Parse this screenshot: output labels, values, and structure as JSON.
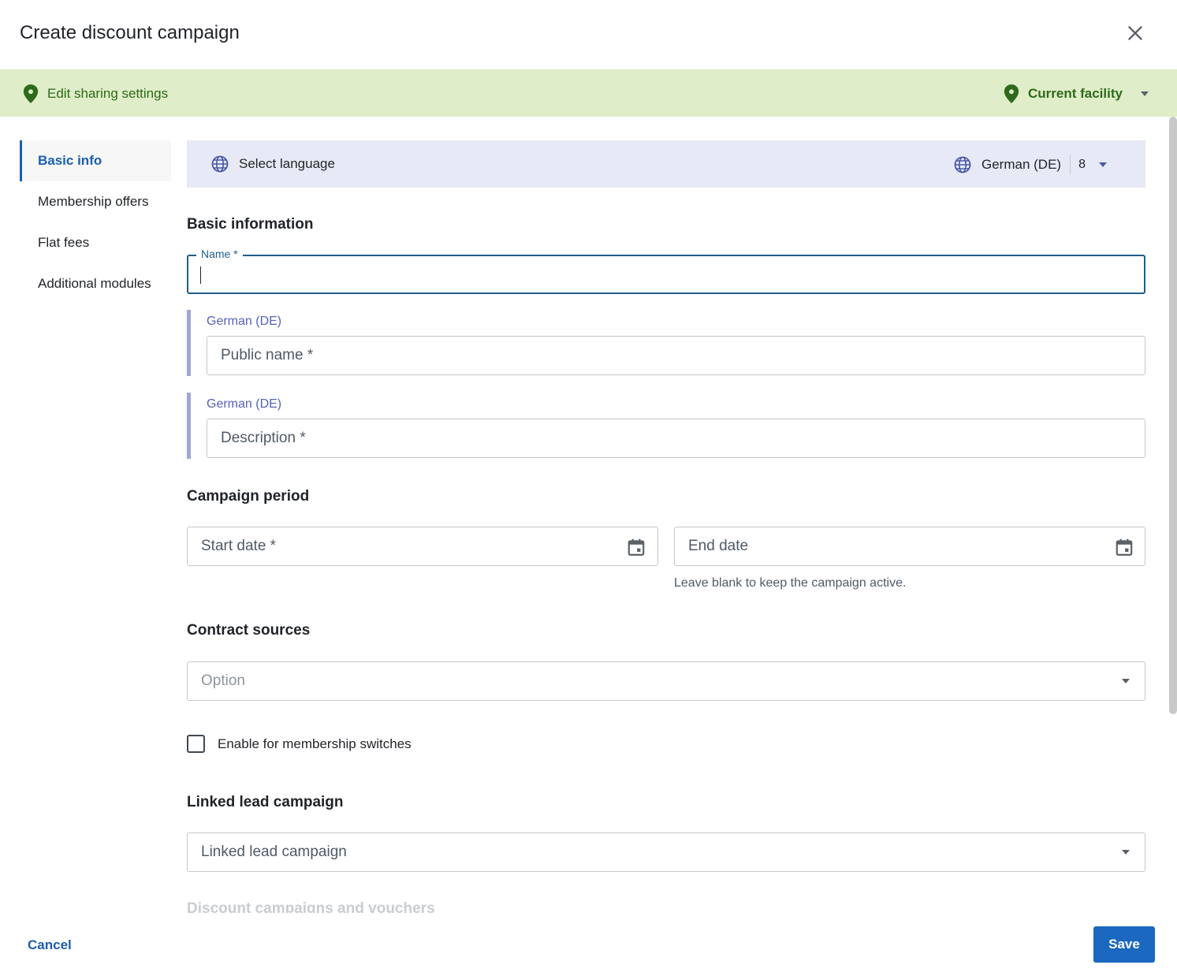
{
  "dialog": {
    "title": "Create discount campaign",
    "close_icon": "close-icon"
  },
  "sharing": {
    "label": "Edit sharing settings",
    "facility": "Current facility",
    "accent_color": "#2e6a1b"
  },
  "sidebar": {
    "items": [
      {
        "label": "Basic info",
        "active": true
      },
      {
        "label": "Membership offers",
        "active": false
      },
      {
        "label": "Flat fees",
        "active": false
      },
      {
        "label": "Additional modules",
        "active": false
      }
    ]
  },
  "language": {
    "select_label": "Select language",
    "current": "German (DE)",
    "count": "8"
  },
  "basic_information": {
    "title": "Basic information",
    "name_label": "Name *",
    "name_value": "",
    "public_name": {
      "lang": "German (DE)",
      "placeholder": "Public name *"
    },
    "description": {
      "lang": "German (DE)",
      "placeholder": "Description *"
    }
  },
  "campaign_period": {
    "title": "Campaign period",
    "start_placeholder": "Start date *",
    "end_placeholder": "End date",
    "end_helper": "Leave blank to keep the campaign active."
  },
  "contract_sources": {
    "title": "Contract sources",
    "placeholder": "Option"
  },
  "membership_switch": {
    "label": "Enable for membership switches",
    "checked": false
  },
  "linked_lead": {
    "title": "Linked lead campaign",
    "placeholder": "Linked lead campaign"
  },
  "next_section": {
    "title": "Discount campaigns and vouchers"
  },
  "footer": {
    "cancel_label": "Cancel",
    "save_label": "Save",
    "primary_color": "#1a68bf"
  }
}
